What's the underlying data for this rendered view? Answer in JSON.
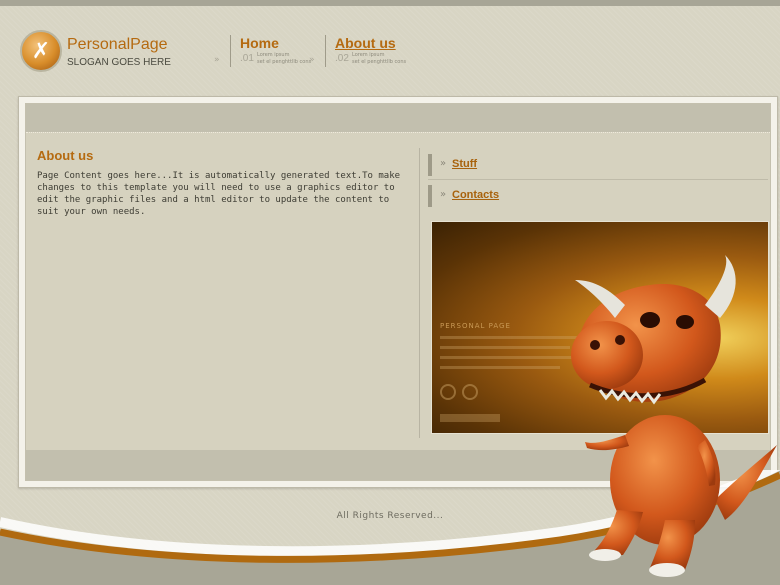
{
  "brand": {
    "title": "PersonalPage",
    "slogan": "SLOGAN GOES HERE"
  },
  "nav": [
    {
      "label": "Home",
      "num": ".01",
      "sub1": "Lorem ipsum",
      "sub2": "set el penghttllb cons"
    },
    {
      "label": "About us",
      "num": ".02",
      "sub1": "Lorem ipsum",
      "sub2": "set el penghttllb cons"
    }
  ],
  "content": {
    "title": "About us",
    "body": "Page Content goes here...It is automatically generated text.To make changes to this template you will need to use a graphics editor to edit the graphic files and a html editor to update the content to suit your own needs."
  },
  "sidebar": {
    "links": [
      "Stuff",
      "Contacts"
    ]
  },
  "preview": {
    "title": "PERSONAL PAGE"
  },
  "footer": {
    "text": "All Rights Reserved..."
  },
  "colors": {
    "accent": "#b56a10",
    "background": "#d8d5c4",
    "panel": "#d6d2bf"
  },
  "icons": {
    "logo": "logo-x-icon",
    "nav_arrows": "double-chevron-right-icon",
    "mascot": "dino-mascot-illustration"
  }
}
